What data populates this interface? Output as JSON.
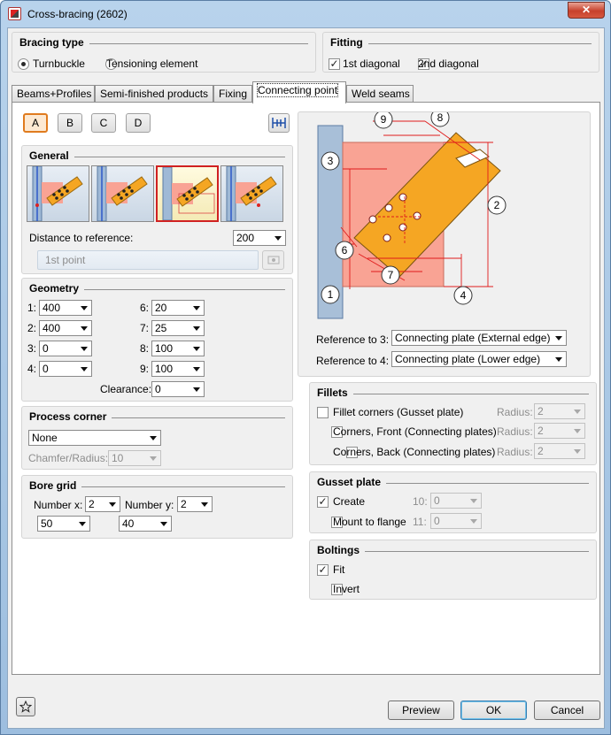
{
  "window": {
    "title": "Cross-bracing (2602)",
    "close_label": "✕"
  },
  "bracing_type": {
    "title": "Bracing type",
    "options": [
      {
        "label": "Turnbuckle",
        "selected": true
      },
      {
        "label": "Tensioning element",
        "selected": false
      }
    ]
  },
  "fitting": {
    "title": "Fitting",
    "options": [
      {
        "label": "1st diagonal",
        "checked": true
      },
      {
        "label": "2nd diagonal",
        "checked": true
      }
    ]
  },
  "tabs": [
    {
      "label": "Beams+Profiles",
      "active": false
    },
    {
      "label": "Semi-finished products",
      "active": false
    },
    {
      "label": "Fixing",
      "active": false
    },
    {
      "label": "Connecting point",
      "active": true
    },
    {
      "label": "Weld seams",
      "active": false
    }
  ],
  "variants": [
    {
      "label": "A",
      "active": true
    },
    {
      "label": "B",
      "active": false
    },
    {
      "label": "C",
      "active": false
    },
    {
      "label": "D",
      "active": false
    }
  ],
  "general": {
    "title": "General",
    "selected_thumbnail": 3,
    "distance_label": "Distance to reference:",
    "distance_value": "200",
    "point_placeholder": "1st point"
  },
  "geometry": {
    "title": "Geometry",
    "left": [
      {
        "label": "1:",
        "value": "400"
      },
      {
        "label": "2:",
        "value": "400"
      },
      {
        "label": "3:",
        "value": "0"
      },
      {
        "label": "4:",
        "value": "0"
      }
    ],
    "right": [
      {
        "label": "6:",
        "value": "20"
      },
      {
        "label": "7:",
        "value": "25"
      },
      {
        "label": "8:",
        "value": "100"
      },
      {
        "label": "9:",
        "value": "100"
      }
    ],
    "clearance_label": "Clearance:",
    "clearance_value": "0"
  },
  "process_corner": {
    "title": "Process corner",
    "value": "None",
    "chamfer_label": "Chamfer/Radius:",
    "chamfer_value": "10"
  },
  "bore_grid": {
    "title": "Bore grid",
    "number_x_label": "Number x:",
    "number_x": "2",
    "number_y_label": "Number y:",
    "number_y": "2",
    "spacing_x": "50",
    "spacing_y": "40"
  },
  "diagram": {
    "callouts": [
      "1",
      "2",
      "3",
      "4",
      "6",
      "7",
      "8",
      "9"
    ],
    "ref3_label": "Reference to 3:",
    "ref3_value": "Connecting plate (External edge)",
    "ref4_label": "Reference to 4:",
    "ref4_value": "Connecting plate (Lower edge)"
  },
  "fillets": {
    "title": "Fillets",
    "items": [
      {
        "label": "Fillet corners (Gusset plate)",
        "radius_label": "Radius:",
        "radius": "2"
      },
      {
        "label": "Corners, Front (Connecting plates)",
        "radius_label": "Radius:",
        "radius": "2"
      },
      {
        "label": "Corners, Back (Connecting plates)",
        "radius_label": "Radius:",
        "radius": "2"
      }
    ]
  },
  "gusset_plate": {
    "title": "Gusset plate",
    "create_label": "Create",
    "create_checked": true,
    "field10_label": "10:",
    "field10": "0",
    "mount_label": "Mount to flange",
    "mount_checked": false,
    "field11_label": "11:",
    "field11": "0"
  },
  "boltings": {
    "title": "Boltings",
    "fit_label": "Fit",
    "fit_checked": true,
    "invert_label": "Invert",
    "invert_checked": false
  },
  "buttons": {
    "preview": "Preview",
    "ok": "OK",
    "cancel": "Cancel",
    "favorite_icon": "star-icon"
  },
  "colors": {
    "plate": "#f9a394",
    "profile": "#f5a623",
    "column": "#a8bfd8",
    "dim": "#e01b1b"
  }
}
